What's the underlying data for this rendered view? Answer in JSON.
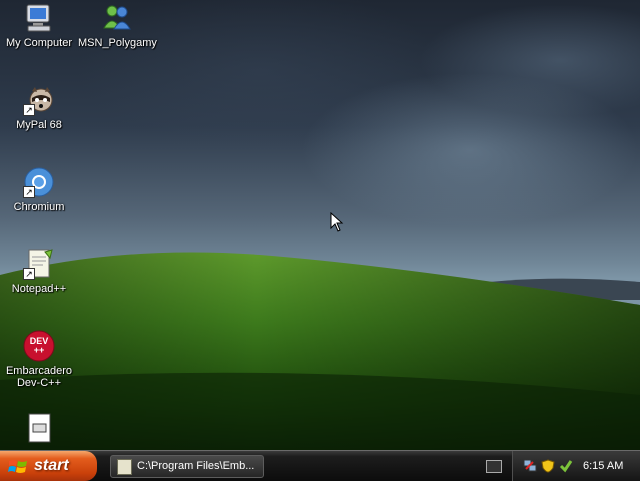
{
  "desktop": {
    "icons": [
      {
        "label": "My Computer",
        "icon": "computer-icon"
      },
      {
        "label": "MSN_Polygamy",
        "icon": "msn-users-icon"
      },
      {
        "label": "MyPal 68",
        "icon": "mypal-raccoon-icon"
      },
      {
        "label": "Chromium",
        "icon": "chromium-icon"
      },
      {
        "label": "Notepad++",
        "icon": "notepad-plus-plus-icon"
      },
      {
        "label": "Embarcadero Dev-C++",
        "icon": "dev-cpp-icon"
      },
      {
        "label": "",
        "icon": "file-icon"
      }
    ],
    "dev_icon_text": "DEV ++"
  },
  "taskbar": {
    "start_label": "start",
    "task_item_label": "C:\\Program Files\\Emb...",
    "clock": "6:15 AM"
  },
  "colors": {
    "start_button": "#d9531a",
    "taskbar": "#111111"
  }
}
